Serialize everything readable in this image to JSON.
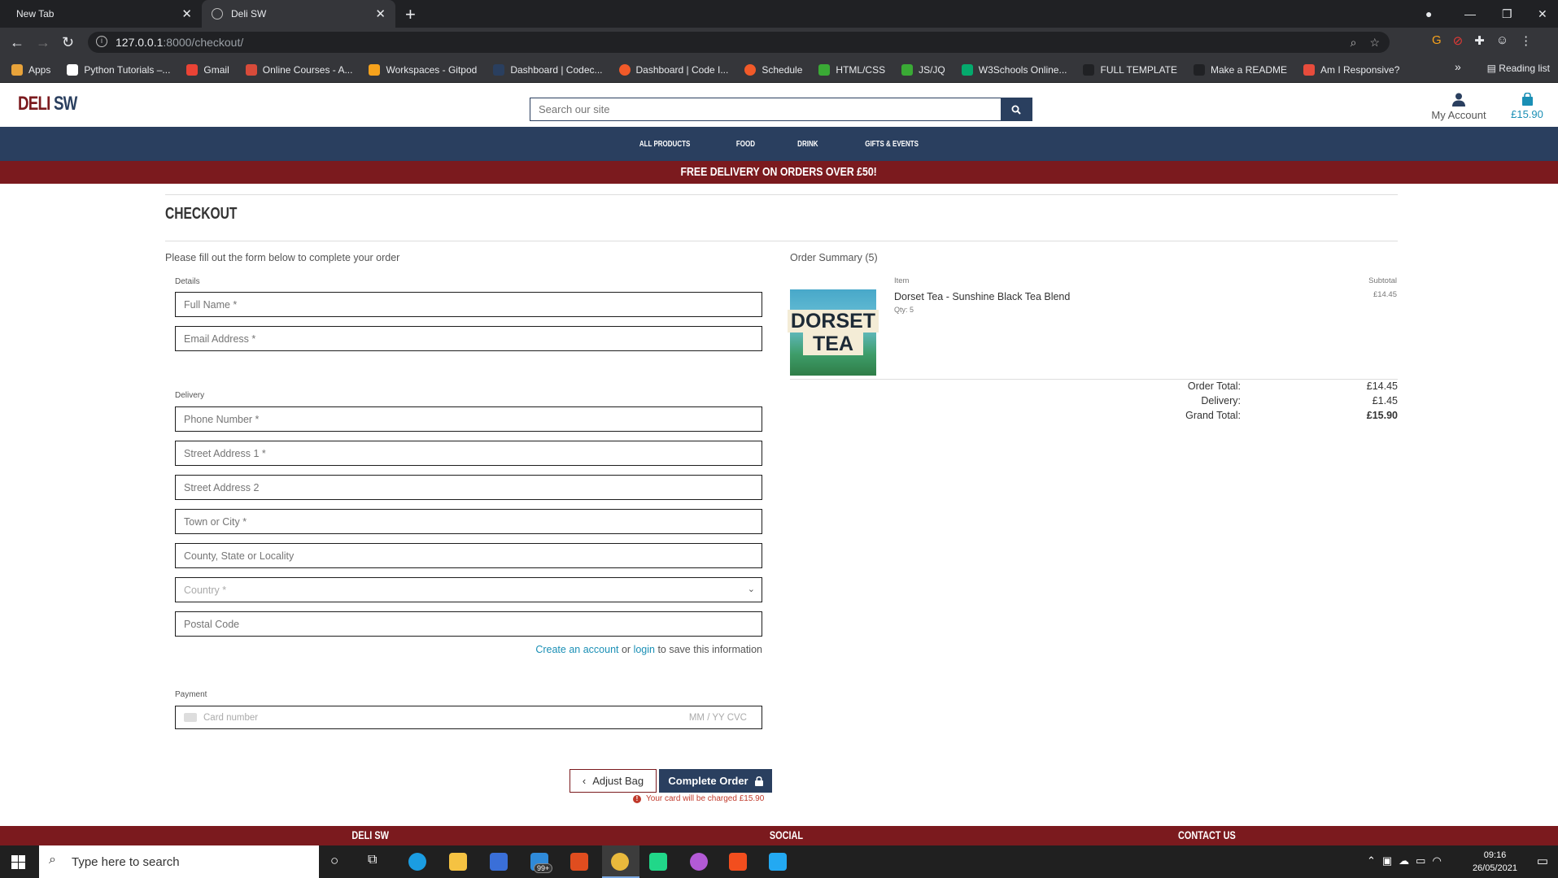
{
  "browser": {
    "tabs": [
      {
        "title": "New Tab"
      },
      {
        "title": "Deli SW"
      }
    ],
    "url_host": "127.0.0.1",
    "url_path": ":8000/checkout/",
    "bookmarks": [
      {
        "label": "Apps",
        "color": "#e8a33a"
      },
      {
        "label": "Python Tutorials –...",
        "color": "#ffffff"
      },
      {
        "label": "Gmail",
        "color": "#ea4335"
      },
      {
        "label": "Online Courses - A...",
        "color": "#d84b3a"
      },
      {
        "label": "Workspaces - Gitpod",
        "color": "#f6a21c"
      },
      {
        "label": "Dashboard | Codec...",
        "color": "#2a3f5f"
      },
      {
        "label": "Dashboard | Code I...",
        "color": "#f15a29"
      },
      {
        "label": "Schedule",
        "color": "#f15a29"
      },
      {
        "label": "HTML/CSS",
        "color": "#3aaa35"
      },
      {
        "label": "JS/JQ",
        "color": "#3aaa35"
      },
      {
        "label": "W3Schools Online...",
        "color": "#04aa6d"
      },
      {
        "label": "FULL TEMPLATE",
        "color": "#202124"
      },
      {
        "label": "Make a README",
        "color": "#202124"
      },
      {
        "label": "Am I Responsive?",
        "color": "#e74c3c"
      }
    ],
    "reading_list": "Reading list",
    "more": "»"
  },
  "header": {
    "logo_part1": "DELI",
    "logo_part2": "SW",
    "search_placeholder": "Search our site",
    "account_label": "My Account",
    "bag_total": "£15.90"
  },
  "nav": [
    "All Products",
    "Food",
    "Drink",
    "Gifts & Events"
  ],
  "banner": "FREE DELIVERY ON ORDERS OVER £50!",
  "checkout": {
    "title": "CHECKOUT",
    "intro": "Please fill out the form below to complete your order",
    "details_label": "Details",
    "full_name": "Full Name *",
    "email": "Email Address *",
    "delivery_label": "Delivery",
    "phone": "Phone Number *",
    "street1": "Street Address 1 *",
    "street2": "Street Address 2",
    "town": "Town or City *",
    "county": "County, State or Locality",
    "country": "Country *",
    "postcode": "Postal Code",
    "create_account": "Create an account",
    "or": " or ",
    "login": "login",
    "save_suffix": " to save this information",
    "payment_label": "Payment",
    "card_number": "Card number",
    "card_exp": "MM / YY  CVC",
    "adjust_bag": "Adjust Bag",
    "complete_order": "Complete Order",
    "charge_notice": "Your card will be charged £15.90"
  },
  "summary": {
    "title": "Order Summary (5)",
    "col_item": "Item",
    "col_subtotal": "Subtotal",
    "product_image_text_1": "DORSET",
    "product_image_text_2": "TEA",
    "item_name": "Dorset Tea - Sunshine Black Tea Blend",
    "item_qty": "Qty: 5",
    "item_subtotal": "£14.45",
    "order_total_label": "Order Total:",
    "order_total": "£14.45",
    "delivery_label": "Delivery:",
    "delivery": "£1.45",
    "grand_total_label": "Grand Total:",
    "grand_total": "£15.90"
  },
  "footer": {
    "col1": "DELI SW",
    "col2": "SOCIAL",
    "col3": "CONTACT US"
  },
  "taskbar": {
    "search_placeholder": "Type here to search",
    "time": "09:16",
    "date": "26/05/2021",
    "mail_badge": "99+"
  },
  "colors": {
    "brand_blue": "#2a3f5f",
    "brand_red": "#7b1a1e",
    "link": "#1a8fb5"
  }
}
